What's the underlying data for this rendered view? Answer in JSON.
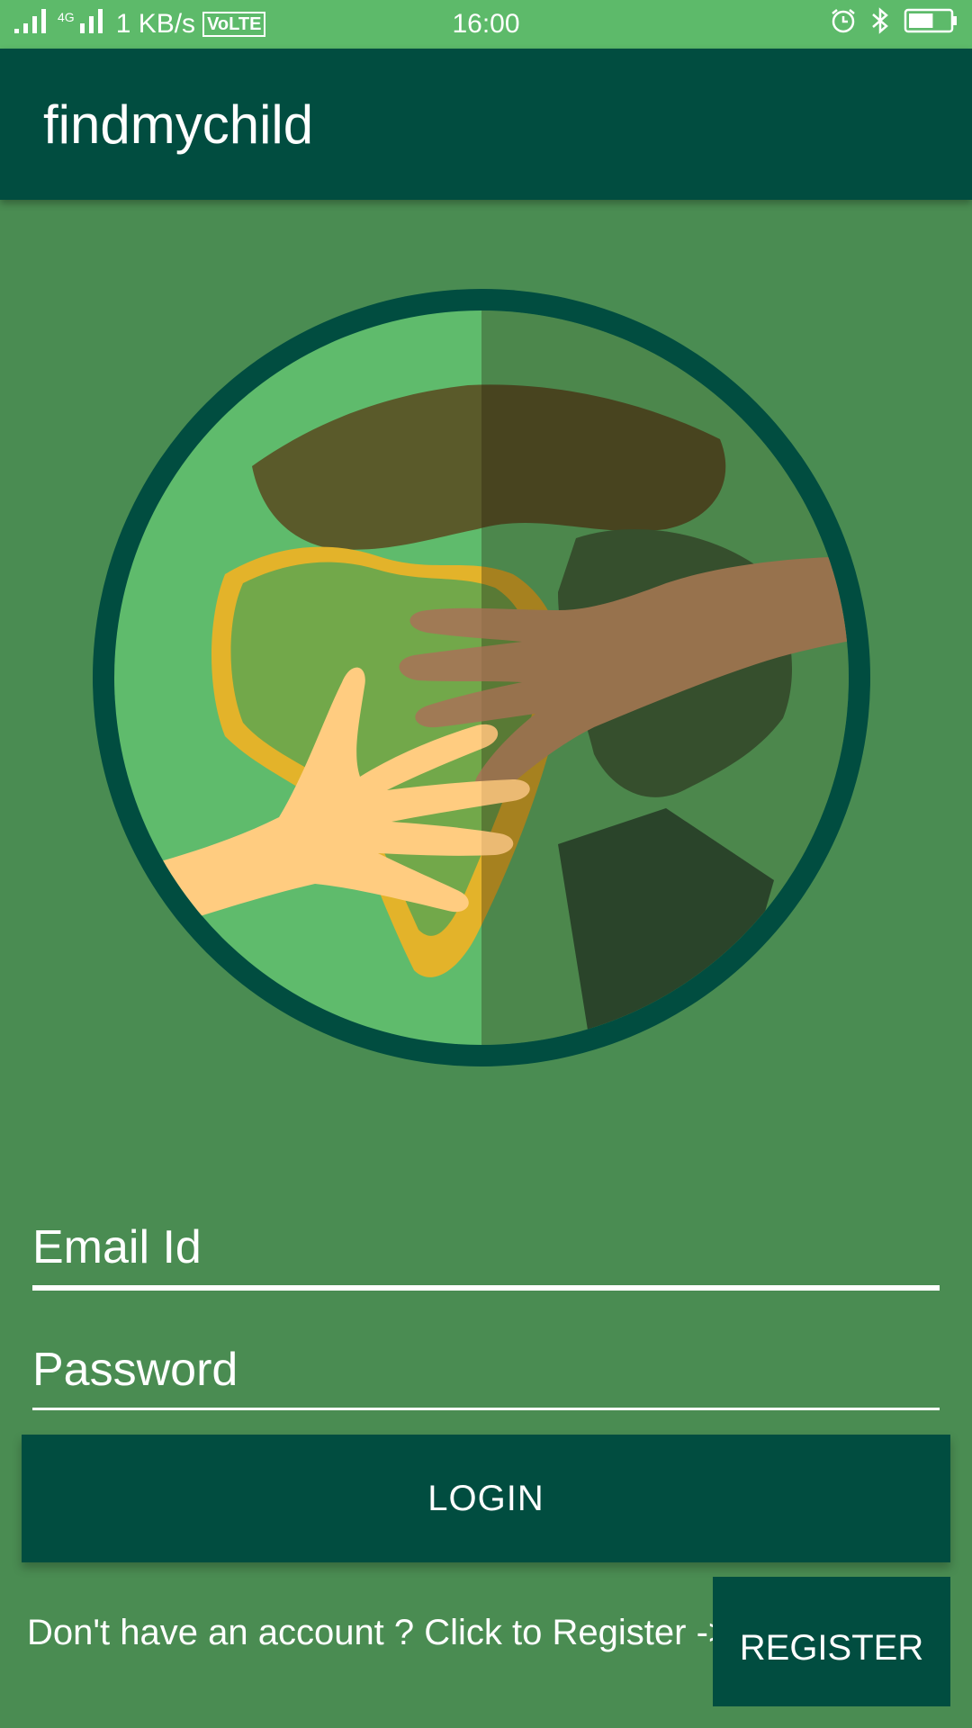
{
  "status_bar": {
    "network_speed": "1 KB/s",
    "network_type": "4G",
    "volte": "VoLTE",
    "time": "16:00",
    "icons": [
      "signal-icon",
      "signal-4g-icon",
      "alarm-icon",
      "bluetooth-icon",
      "battery-icon"
    ],
    "battery_level": 0.6
  },
  "app_bar": {
    "title": "findmychild",
    "color": "#014d40"
  },
  "logo": {
    "description_icon": "globe-hands-logo"
  },
  "form": {
    "email_placeholder": "Email Id",
    "email_value": "",
    "password_placeholder": "Password",
    "password_value": "",
    "login_label": "LOGIN"
  },
  "footer": {
    "register_prompt": "Don't have an account ? Click to Register ->",
    "register_label": "REGISTER"
  },
  "colors": {
    "background": "#4a8c52",
    "status_bar": "#5dba6a",
    "primary_dark": "#014d40"
  }
}
